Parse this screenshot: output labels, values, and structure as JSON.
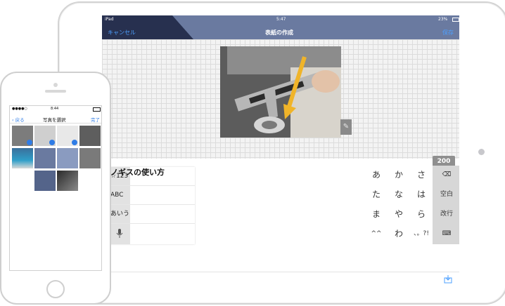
{
  "ipad": {
    "status": {
      "device": "iPad",
      "time": "5:47",
      "battery": "23%"
    },
    "nav": {
      "cancel": "キャンセル",
      "title": "表紙の作成",
      "save": "保存"
    },
    "caption": "ノギスの使い方",
    "keyboard": {
      "left_items": [
        "☆123",
        "ABC",
        "あいう",
        ""
      ],
      "kana_keys": [
        [
          "あ",
          "か",
          "さ"
        ],
        [
          "た",
          "な",
          "は"
        ],
        [
          "ま",
          "や",
          "ら"
        ],
        [
          "^^",
          "わ",
          "、。?!"
        ]
      ],
      "function_keys": [
        "⌫",
        "空白",
        "改行",
        "⌨"
      ]
    },
    "badge": "200"
  },
  "iphone": {
    "status": {
      "time": "8:44"
    },
    "nav": {
      "back": "戻る",
      "title": "写真を選択",
      "done": "完了"
    }
  },
  "colors": {
    "nav_bar": "#6a7aa0",
    "nav_dark": "#27304f",
    "link": "#4da0ff",
    "check": "#2f7ce6"
  }
}
